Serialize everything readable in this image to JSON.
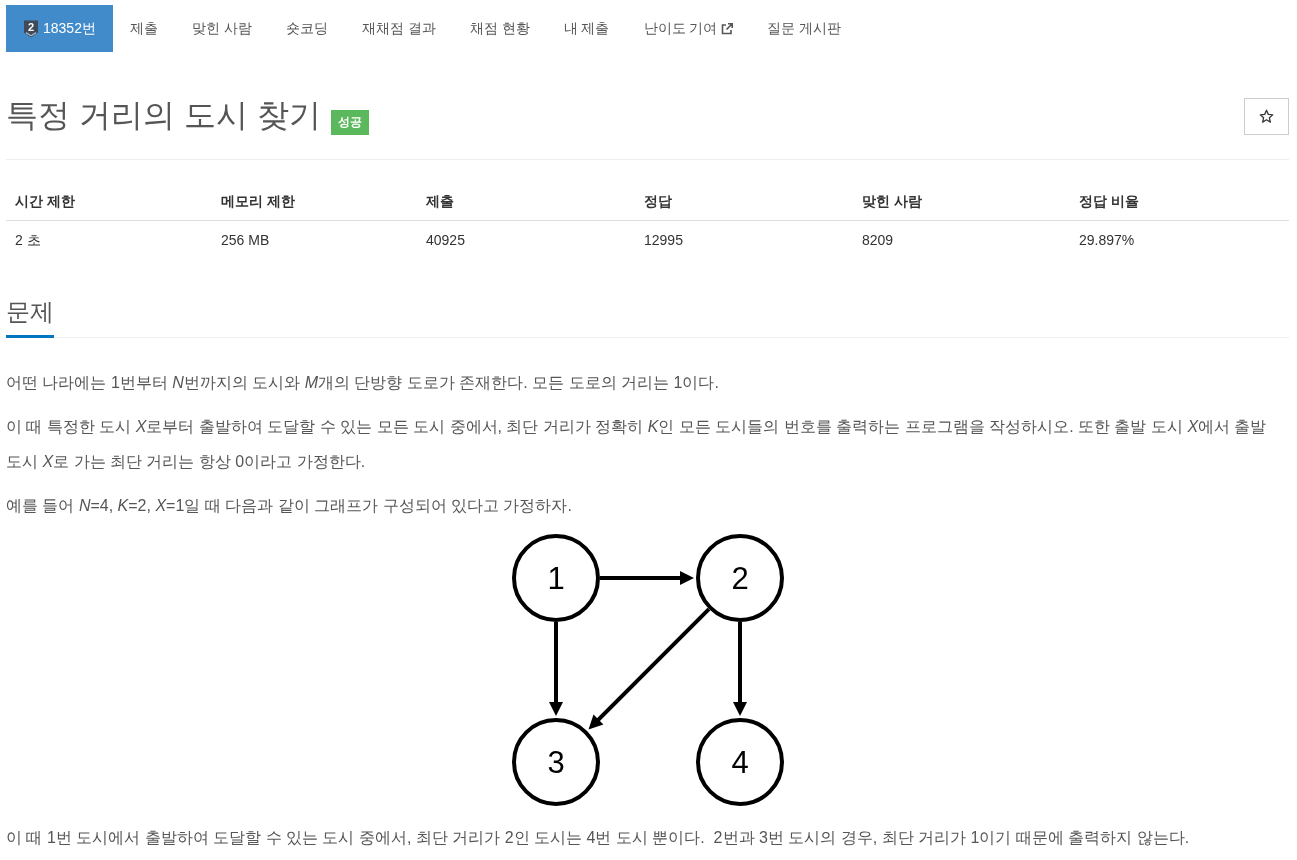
{
  "nav": {
    "tabs": [
      {
        "label": "18352번",
        "selected": true,
        "tier": "2"
      },
      {
        "label": "제출",
        "selected": false
      },
      {
        "label": "맞힌 사람",
        "selected": false
      },
      {
        "label": "숏코딩",
        "selected": false
      },
      {
        "label": "재채점 결과",
        "selected": false
      },
      {
        "label": "채점 현황",
        "selected": false
      },
      {
        "label": "내 제출",
        "selected": false
      },
      {
        "label": "난이도 기여",
        "selected": false,
        "external": true
      },
      {
        "label": "질문 게시판",
        "selected": false
      }
    ]
  },
  "problem": {
    "title": "특정 거리의 도시 찾기",
    "status": "성공",
    "starred": false
  },
  "stats": {
    "columns": [
      "시간 제한",
      "메모리 제한",
      "제출",
      "정답",
      "맞힌 사람",
      "정답 비율"
    ],
    "rows": [
      [
        "2 초",
        "256 MB",
        "40925",
        "12995",
        "8209",
        "29.897%"
      ]
    ]
  },
  "sections": [
    {
      "heading": "문제",
      "content": [
        {
          "kind": "paragraph",
          "runs": [
            {
              "text": "어떤 나라에는 1번부터 ",
              "italic": false
            },
            {
              "text": "N",
              "italic": true
            },
            {
              "text": "번까지의 도시와 ",
              "italic": false
            },
            {
              "text": "M",
              "italic": true
            },
            {
              "text": "개의 단방향 도로가 존재한다. 모든 도로의 거리는 1이다.",
              "italic": false
            }
          ]
        },
        {
          "kind": "paragraph",
          "runs": [
            {
              "text": "이 때 특정한 도시 ",
              "italic": false
            },
            {
              "text": "X",
              "italic": true
            },
            {
              "text": "로부터 출발하여 도달할 수 있는 모든 도시 중에서, 최단 거리가 정확히 ",
              "italic": false
            },
            {
              "text": "K",
              "italic": true
            },
            {
              "text": "인 모든 도시들의 번호를 출력하는 프로그램을 작성하시오. 또한 출발 도시 ",
              "italic": false
            },
            {
              "text": "X",
              "italic": true
            },
            {
              "text": "에서 출발 도시 ",
              "italic": false
            },
            {
              "text": "X",
              "italic": true
            },
            {
              "text": "로 가는 최단 거리는 항상 0이라고 가정한다.",
              "italic": false
            }
          ]
        },
        {
          "kind": "paragraph",
          "text": "예를 들어 *N*=4, *K*=2, *X*=1일 때 다음과 같이 그래프가 구성되어 있다고 가정하자."
        },
        {
          "kind": "graph",
          "nodes": [
            {
              "label": "1",
              "arrow_to": [
                false,
                true,
                true,
                false
              ]
            },
            {
              "label": "2",
              "arrow_to": [
                false,
                false,
                true,
                true
              ]
            },
            {
              "label": "3",
              "arrow_to": [
                false,
                false,
                false,
                false
              ]
            },
            {
              "label": "4",
              "arrow_to": [
                false,
                false,
                false,
                false
              ]
            }
          ]
        },
        {
          "kind": "paragraph",
          "text": "이 때 1번 도시에서 출발하여 도달할 수 있는 도시 중에서, 최단 거리가 2인 도시는 4번 도시 뿐이다.  2번과 3번 도시의 경우, 최단 거리가 1이기 때문에 출력하지 않는다."
        }
      ]
    }
  ]
}
